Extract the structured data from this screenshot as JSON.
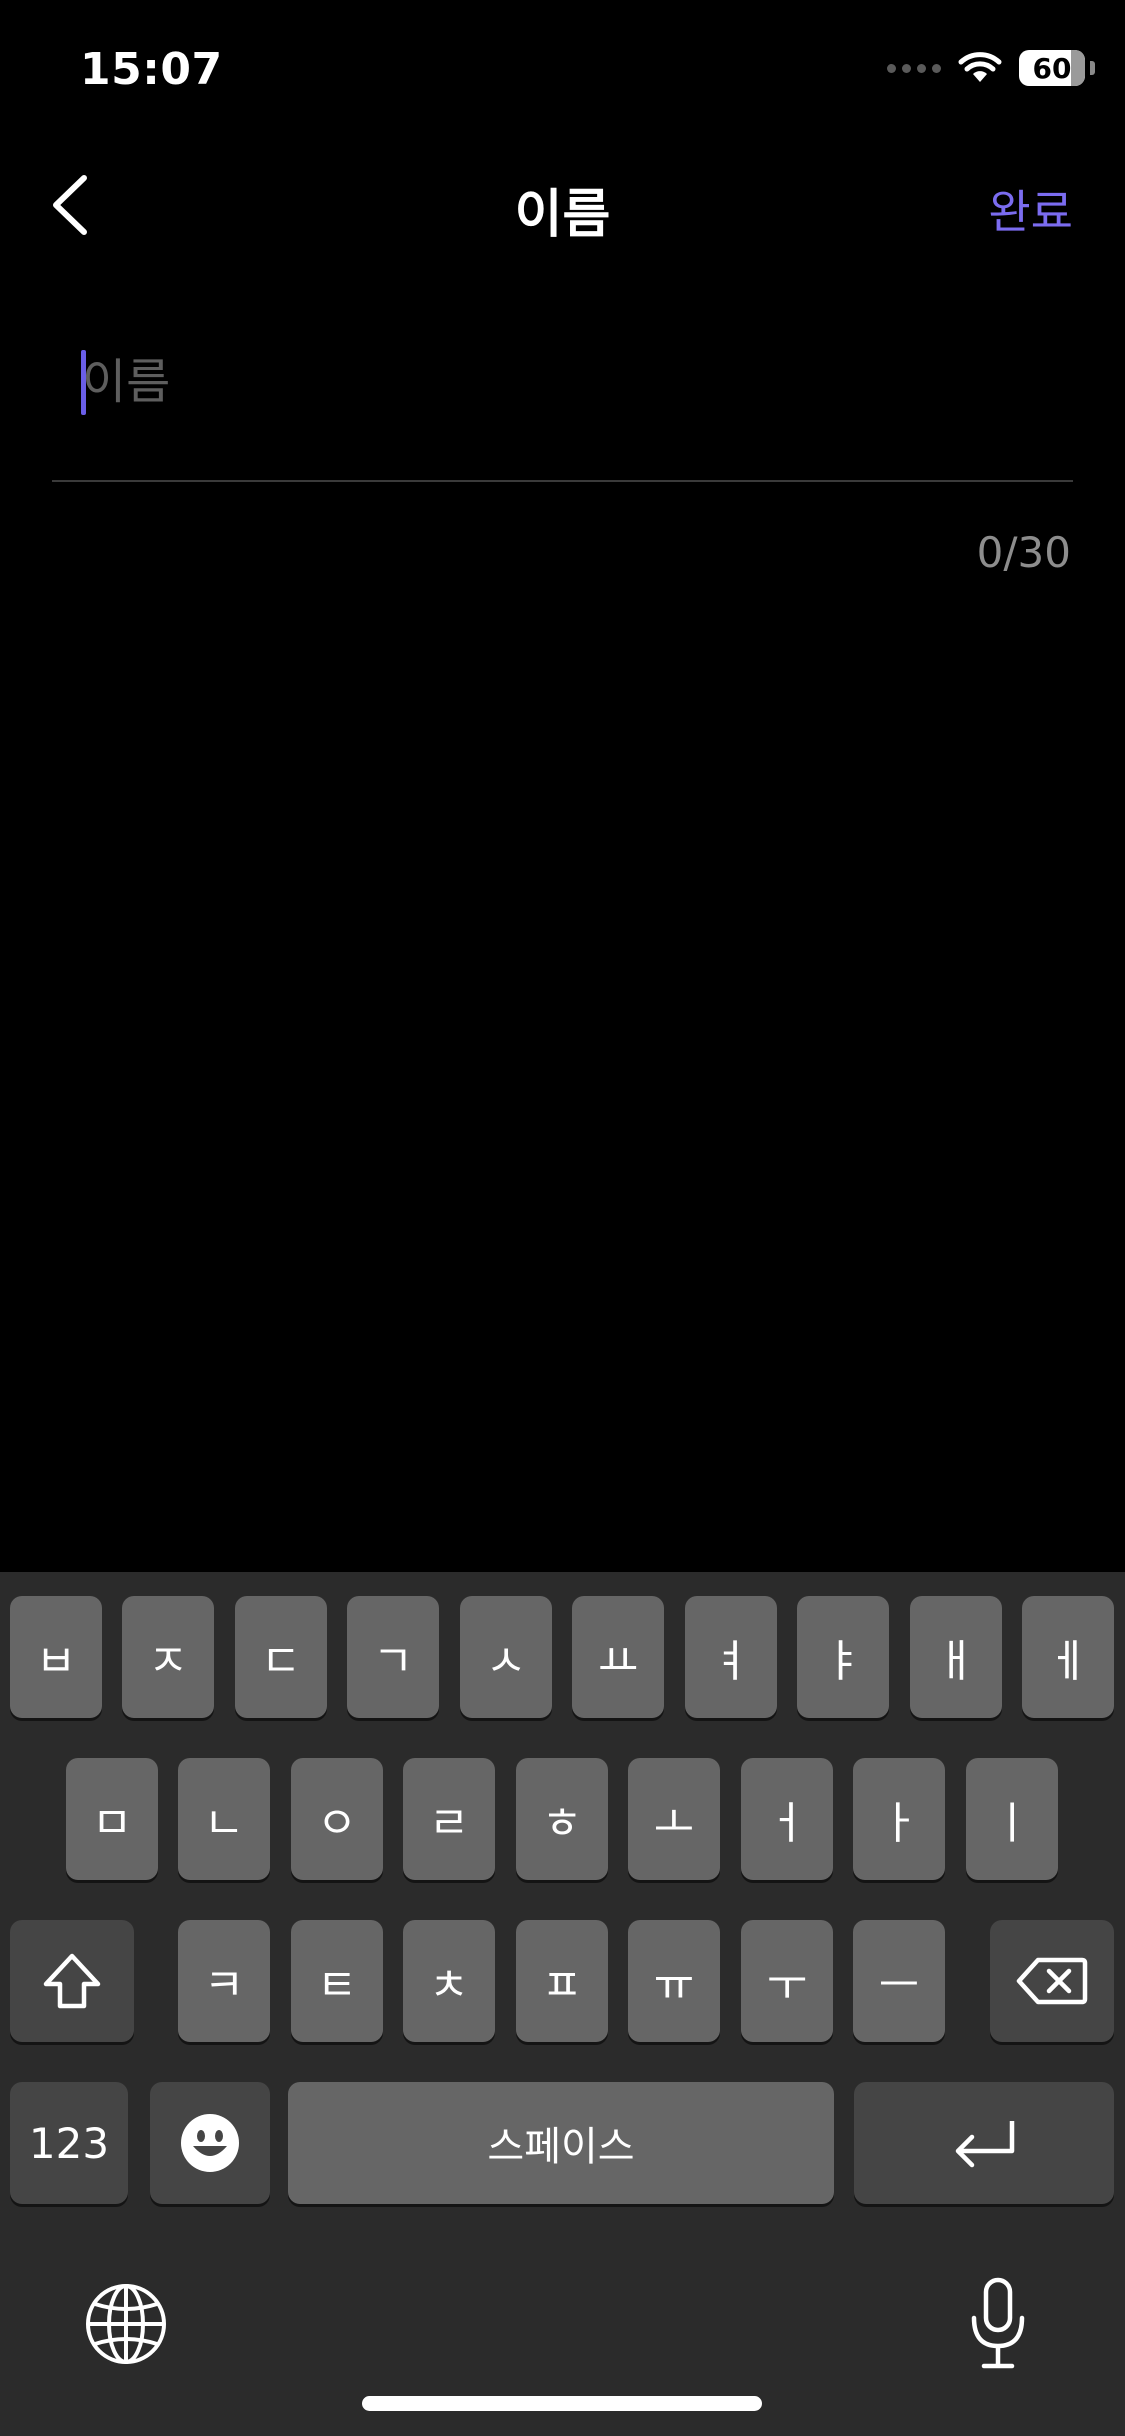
{
  "status_bar": {
    "time": "15:07",
    "battery": "60"
  },
  "nav": {
    "title": "이름",
    "done_label": "완료"
  },
  "name_field": {
    "placeholder": "이름",
    "value": "",
    "counter": "0/30"
  },
  "keyboard": {
    "row1": [
      "ㅂ",
      "ㅈ",
      "ㄷ",
      "ㄱ",
      "ㅅ",
      "ㅛ",
      "ㅕ",
      "ㅑ",
      "ㅐ",
      "ㅔ"
    ],
    "row2": [
      "ㅁ",
      "ㄴ",
      "ㅇ",
      "ㄹ",
      "ㅎ",
      "ㅗ",
      "ㅓ",
      "ㅏ",
      "ㅣ"
    ],
    "row3": [
      "ㅋ",
      "ㅌ",
      "ㅊ",
      "ㅍ",
      "ㅠ",
      "ㅜ",
      "ㅡ"
    ],
    "numbers_label": "123",
    "space_label": "스페이스"
  },
  "colors": {
    "accent": "#7b6cf0",
    "cursor": "#6a5ee8",
    "key": "#666666",
    "key_dark": "#454545",
    "keyboard_bg": "#2b2b2b"
  },
  "icons": [
    "back-chevron-icon",
    "wifi-icon",
    "shift-icon",
    "delete-icon",
    "emoji-icon",
    "return-icon",
    "globe-icon",
    "microphone-icon"
  ]
}
